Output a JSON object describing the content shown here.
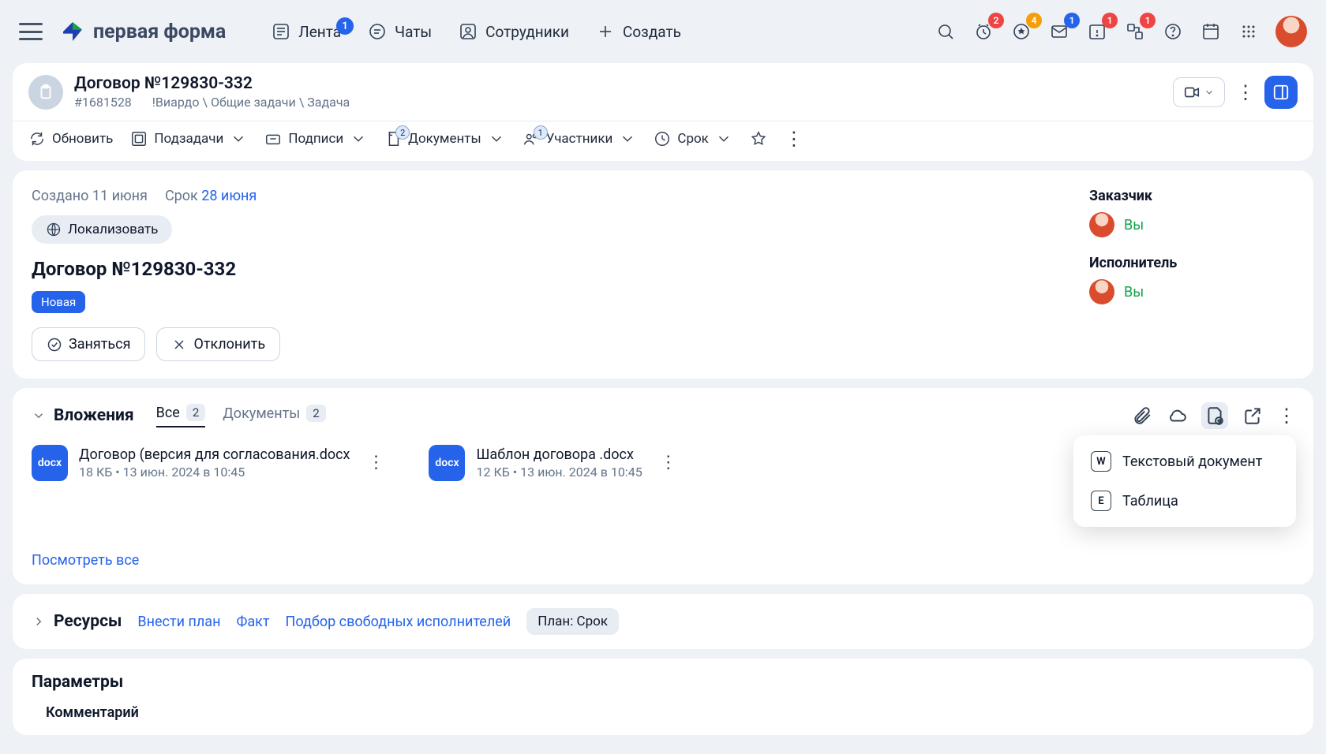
{
  "logo_text": "первая форма",
  "nav": {
    "feed": "Лента",
    "feed_badge": "1",
    "chats": "Чаты",
    "staff": "Сотрудники",
    "create": "Создать"
  },
  "top_badges": {
    "clock": "2",
    "star": "4",
    "mail": "1",
    "cal": "1",
    "flow": "1"
  },
  "task": {
    "title": "Договор №129830-332",
    "id": "#1681528",
    "breadcrumb": "!Виардо \\ Общие задачи \\ Задача"
  },
  "toolbar": {
    "refresh": "Обновить",
    "subtasks": "Подзадачи",
    "sign": "Подписи",
    "docs": "Документы",
    "docs_badge": "2",
    "members": "Участники",
    "members_badge": "1",
    "due": "Срок"
  },
  "main": {
    "created_label": "Создано 11 июня",
    "due_label": "Срок",
    "due_date": "28 июня",
    "localize": "Локализовать",
    "title": "Договор №129830-332",
    "status": "Новая",
    "take": "Заняться",
    "reject": "Отклонить"
  },
  "roles": {
    "customer_label": "Заказчик",
    "executor_label": "Исполнитель",
    "you": "Вы"
  },
  "attachments": {
    "section": "Вложения",
    "tab_all": "Все",
    "tab_all_cnt": "2",
    "tab_docs": "Документы",
    "tab_docs_cnt": "2",
    "see_all": "Посмотреть все",
    "files": [
      {
        "ext": "docx",
        "name": "Договор (версия для согласования.docx",
        "meta": "18 КБ • 13 июн. 2024 в 10:45"
      },
      {
        "ext": "docx",
        "name": "Шаблон договора .docx",
        "meta": "12 КБ • 13 июн. 2024 в 10:45"
      }
    ]
  },
  "popover": {
    "text_doc": "Текстовый документ",
    "text_doc_tag": "W",
    "sheet": "Таблица",
    "sheet_tag": "E"
  },
  "resources": {
    "title": "Ресурсы",
    "plan": "Внести план",
    "fact": "Факт",
    "pick": "Подбор свободных исполнителей",
    "chip": "План: Срок"
  },
  "params": {
    "title": "Параметры",
    "field": "Комментарий"
  }
}
